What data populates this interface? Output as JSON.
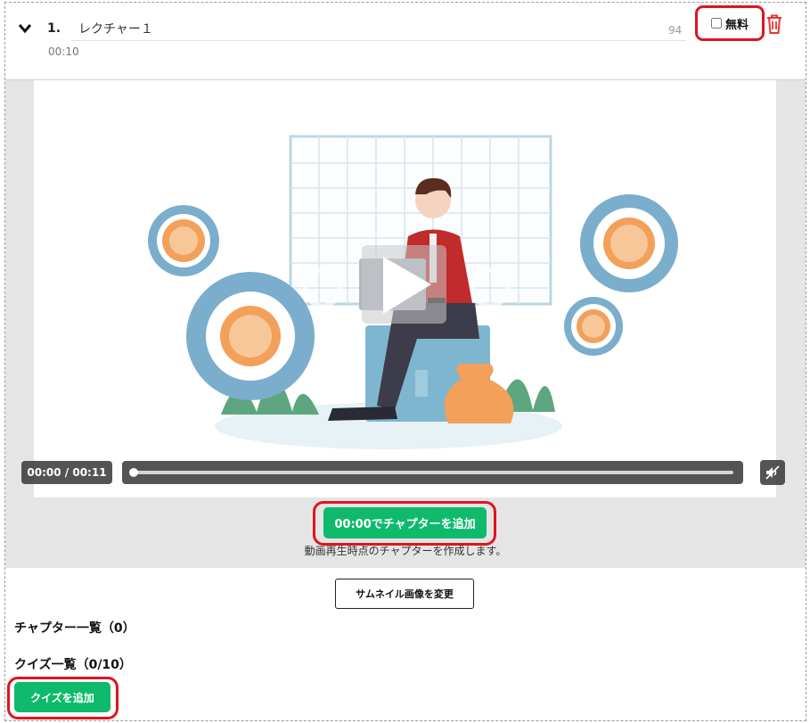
{
  "lecture": {
    "number": "1.",
    "title": "レクチャー１",
    "char_count": "94",
    "duration": "00:10",
    "free_label": "無料",
    "free_checked": false
  },
  "player": {
    "time_display": "00:00 / 00:11",
    "progress": 0.0
  },
  "chapter": {
    "add_button_label": "00:00でチャプターを追加",
    "hint": "動画再生時点のチャプターを作成します。"
  },
  "thumbnail_button_label": "サムネイル画像を変更",
  "chapter_list_title": "チャプター一覧（0）",
  "quiz_list_title": "クイズ一覧（0/10）",
  "quiz_add_button_label": "クイズを追加",
  "icons": {
    "collapse": "chevron-down-icon",
    "delete": "trash-icon",
    "play": "play-icon",
    "rewind": "rewind-icon",
    "forward": "forward-icon",
    "mute": "mute-icon"
  },
  "colors": {
    "accent_green": "#0fba6c",
    "highlight_red": "#e0141e",
    "trash_red": "#e8352f"
  }
}
